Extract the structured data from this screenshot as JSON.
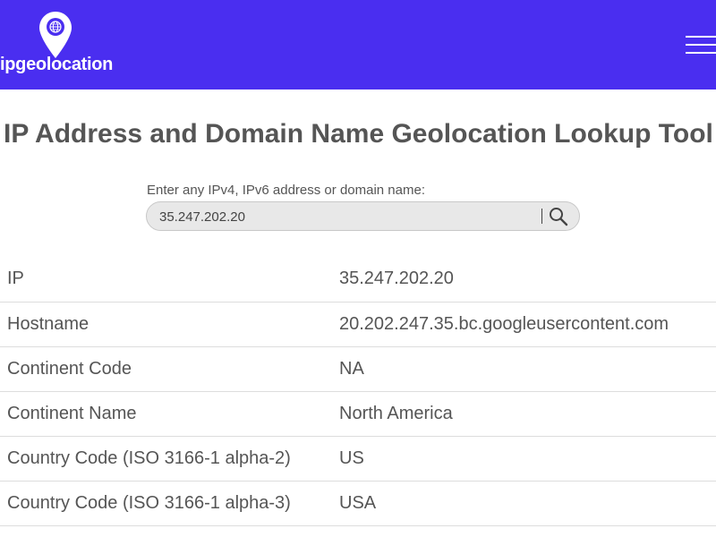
{
  "header": {
    "logo_text": "ipgeolocation",
    "icons": {
      "logo": "location-pin-globe-icon",
      "menu": "hamburger-menu-icon"
    },
    "colors": {
      "header_bg": "#4a2ef0",
      "header_text": "#ffffff"
    }
  },
  "page": {
    "title": "IP Address and Domain Name Geolocation Lookup Tool"
  },
  "search": {
    "label": "Enter any IPv4, IPv6 address or domain name:",
    "value": "35.247.202.20",
    "icon": "search-icon"
  },
  "results": {
    "rows": [
      {
        "key": "IP",
        "value": "35.247.202.20"
      },
      {
        "key": "Hostname",
        "value": "20.202.247.35.bc.googleusercontent.com"
      },
      {
        "key": "Continent Code",
        "value": "NA"
      },
      {
        "key": "Continent Name",
        "value": "North America"
      },
      {
        "key": "Country Code (ISO 3166-1 alpha-2)",
        "value": "US"
      },
      {
        "key": "Country Code (ISO 3166-1 alpha-3)",
        "value": "USA"
      }
    ]
  }
}
